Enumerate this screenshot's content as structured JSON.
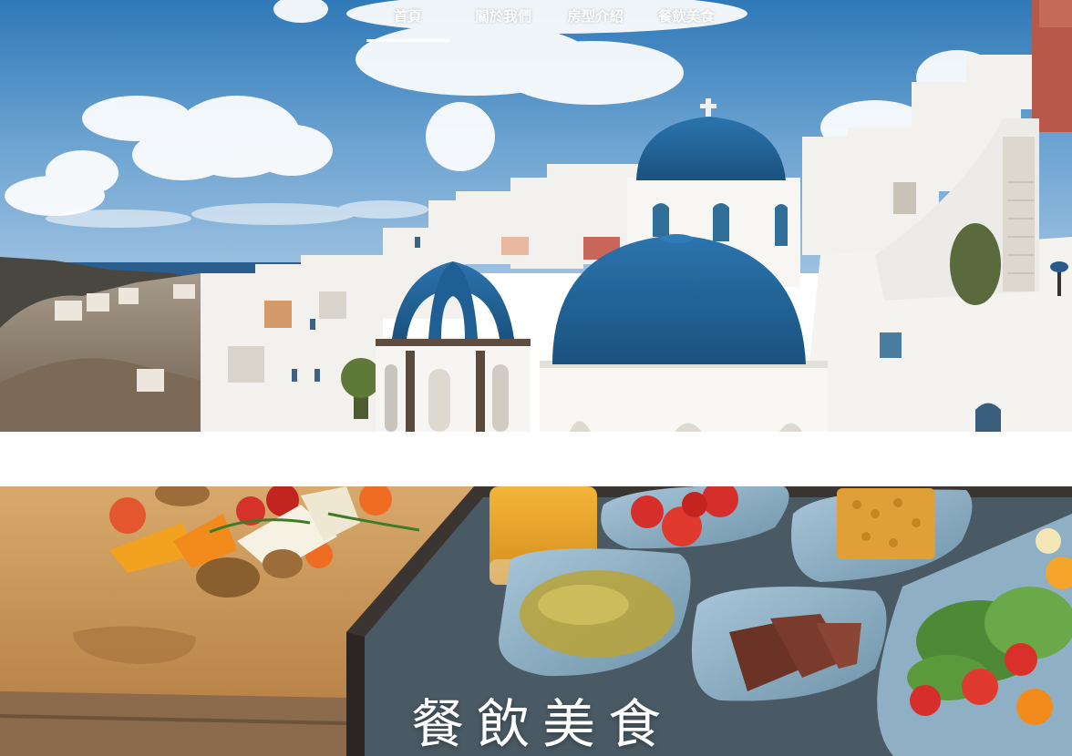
{
  "nav": {
    "items": [
      {
        "label": "首頁",
        "active": true
      },
      {
        "label": "關於我們",
        "active": false
      },
      {
        "label": "房型介紹",
        "active": false
      },
      {
        "label": "餐飲美食",
        "active": false
      }
    ]
  },
  "hero": {
    "image": "santorini-blue-domes-photo"
  },
  "food_section": {
    "title": "餐飲美食",
    "image": "greek-breakfast-tray-photo"
  },
  "colors": {
    "dome_blue": "#1f5f94",
    "sky": "#4f8fc4",
    "nav_text": "#ffffff"
  }
}
